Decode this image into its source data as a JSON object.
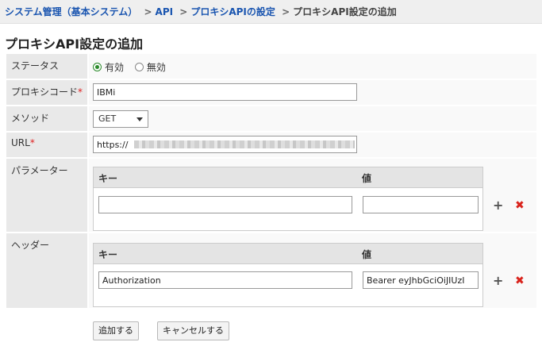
{
  "breadcrumb": {
    "crumbs": [
      "システム管理（基本システム）",
      "API",
      "プロキシAPIの設定"
    ],
    "current": "プロキシAPI設定の追加",
    "separator": ">"
  },
  "page": {
    "title": "プロキシAPI設定の追加"
  },
  "form": {
    "status": {
      "label": "ステータス",
      "options": [
        "有効",
        "無効"
      ],
      "selected": "有効"
    },
    "proxy_code": {
      "label": "プロキシコード",
      "required_mark": "*",
      "value": "IBMi"
    },
    "method": {
      "label": "メソッド",
      "value": "GET"
    },
    "url": {
      "label": "URL",
      "required_mark": "*",
      "value": "https://"
    },
    "parameters": {
      "label": "パラメーター",
      "key_header": "キー",
      "value_header": "値",
      "rows": [
        {
          "key": "",
          "value": ""
        }
      ]
    },
    "headers": {
      "label": "ヘッダー",
      "key_header": "キー",
      "value_header": "値",
      "rows": [
        {
          "key": "Authorization",
          "value": "Bearer eyJhbGciOiJIUzI"
        }
      ]
    }
  },
  "actions": {
    "add": "追加する",
    "cancel": "キャンセルする"
  },
  "icons": {
    "add_row": "+",
    "remove_row": "✖"
  },
  "colors": {
    "link": "#1a55b0",
    "required": "#e02020",
    "remove": "#d9231c",
    "radio_on": "#2a8a2a"
  }
}
